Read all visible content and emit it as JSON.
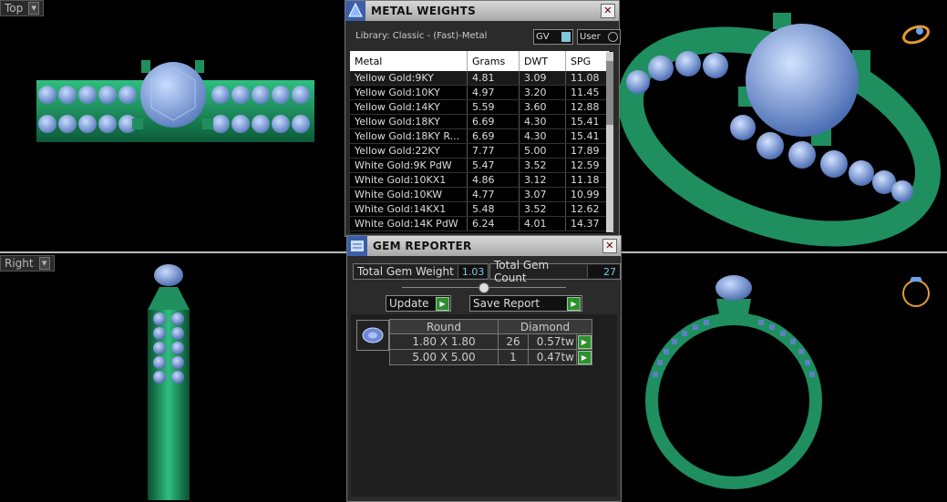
{
  "viewports": {
    "top": {
      "label": "Top"
    },
    "right": {
      "label": "Right"
    }
  },
  "metal_weights": {
    "title": "METAL WEIGHTS",
    "library": "Library: Classic - (Fast)-Metal",
    "gv_label": "GV",
    "user_label": "User",
    "columns": [
      "Metal",
      "Grams",
      "DWT",
      "SPG"
    ],
    "rows": [
      [
        "Yellow Gold:9KY",
        "4.81",
        "3.09",
        "11.08"
      ],
      [
        "Yellow Gold:10KY",
        "4.97",
        "3.20",
        "11.45"
      ],
      [
        "Yellow Gold:14KY",
        "5.59",
        "3.60",
        "12.88"
      ],
      [
        "Yellow Gold:18KY",
        "6.69",
        "4.30",
        "15.41"
      ],
      [
        "Yellow Gold:18KY R...",
        "6.69",
        "4.30",
        "15.41"
      ],
      [
        "Yellow Gold:22KY",
        "7.77",
        "5.00",
        "17.89"
      ],
      [
        "White Gold:9K PdW",
        "5.47",
        "3.52",
        "12.59"
      ],
      [
        "White Gold:10KX1",
        "4.86",
        "3.12",
        "11.18"
      ],
      [
        "White Gold:10KW",
        "4.77",
        "3.07",
        "10.99"
      ],
      [
        "White Gold:14KX1",
        "5.48",
        "3.52",
        "12.62"
      ],
      [
        "White Gold:14K PdW",
        "6.24",
        "4.01",
        "14.37"
      ]
    ]
  },
  "gem_reporter": {
    "title": "GEM REPORTER",
    "total_weight_label": "Total Gem Weight",
    "total_weight_value": "1.03",
    "total_count_label": "Total Gem Count",
    "total_count_value": "27",
    "update_label": "Update",
    "save_label": "Save Report",
    "shape_header": "Round",
    "type_header": "Diamond",
    "rows": [
      {
        "size": "1.80 X 1.80",
        "count": "26",
        "weight": "0.57tw"
      },
      {
        "size": "5.00 X 5.00",
        "count": "1",
        "weight": "0.47tw"
      }
    ]
  },
  "colors": {
    "metal": "#1f8f60",
    "gem": "#8fb0e8",
    "panel": "#2b2b2b"
  }
}
